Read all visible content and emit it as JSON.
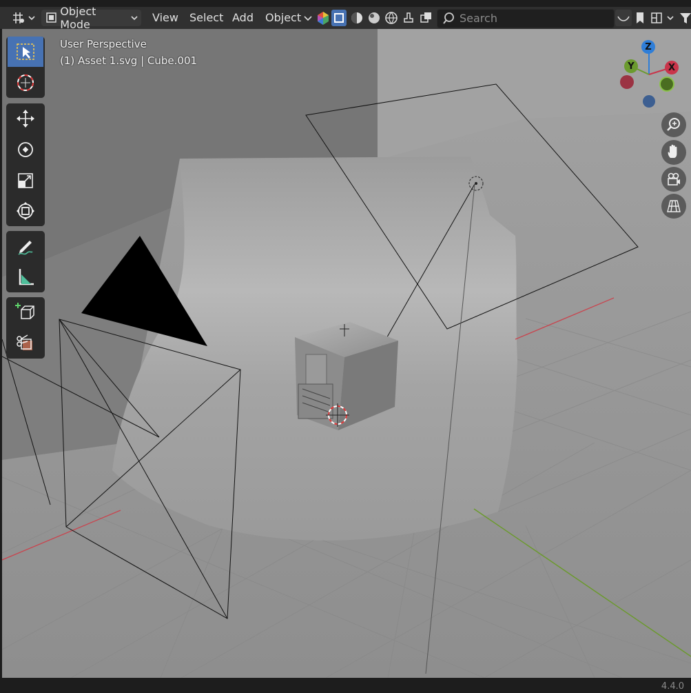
{
  "header": {
    "mode_label": "Object Mode",
    "menus": [
      "View",
      "Select",
      "Add",
      "Object"
    ],
    "search_placeholder": "Search"
  },
  "viewport": {
    "perspective_label": "User Perspective",
    "object_info": "(1) Asset 1.svg | Cube.001"
  },
  "gizmo": {
    "x_label": "X",
    "y_label": "Y",
    "z_label": "Z",
    "colors": {
      "x": "#c9344a",
      "y": "#6b9b2e",
      "z": "#2f7ed8"
    }
  },
  "tools": [
    "select-box",
    "cursor",
    "move",
    "rotate",
    "scale",
    "transform",
    "annotate",
    "measure",
    "add-cube",
    "cut-cube"
  ],
  "status": {
    "version": "4.4.0"
  }
}
